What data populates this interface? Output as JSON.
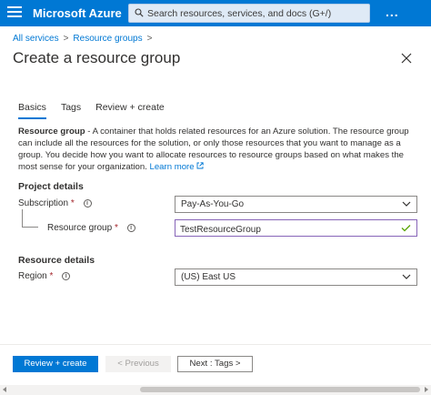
{
  "topbar": {
    "brand": "Microsoft Azure",
    "search_placeholder": "Search resources, services, and docs (G+/)",
    "more": "..."
  },
  "breadcrumb": {
    "items": [
      "All services",
      "Resource groups"
    ],
    "separator": ">"
  },
  "page": {
    "title": "Create a resource group"
  },
  "tabs": [
    {
      "label": "Basics",
      "active": true
    },
    {
      "label": "Tags",
      "active": false
    },
    {
      "label": "Review + create",
      "active": false
    }
  ],
  "description": {
    "bold": "Resource group",
    "text": " - A container that holds related resources for an Azure solution. The resource group can include all the resources for the solution, or only those resources that you want to manage as a group. You decide how you want to allocate resources to resource groups based on what makes the most sense for your organization. ",
    "link": "Learn more"
  },
  "project_details": {
    "title": "Project details",
    "subscription_label": "Subscription",
    "subscription_value": "Pay-As-You-Go",
    "resource_group_label": "Resource group",
    "resource_group_value": "TestResourceGroup"
  },
  "resource_details": {
    "title": "Resource details",
    "region_label": "Region",
    "region_value": "(US) East US"
  },
  "footer": {
    "review_create": "Review + create",
    "previous": "< Previous",
    "next": "Next : Tags >"
  },
  "colors": {
    "accent": "#0078d4",
    "required": "#a4262c",
    "valid": "#57a300",
    "focus_border": "#8764b8"
  },
  "required_marker": "*",
  "info_glyph": "i"
}
